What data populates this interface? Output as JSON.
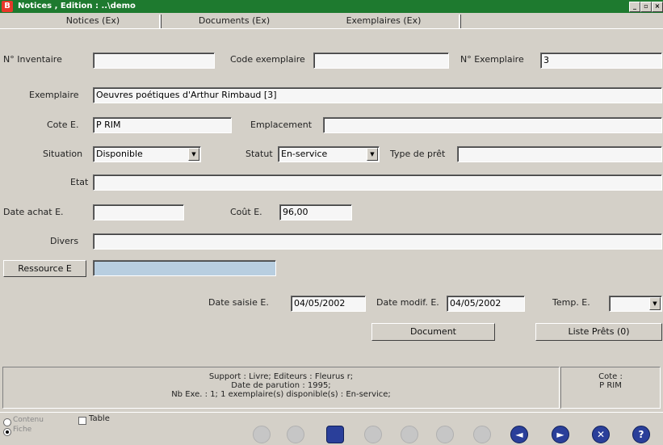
{
  "window": {
    "title": "Notices , Edition : ..\\demo",
    "app_badge": "B",
    "controls": {
      "minimize": "_",
      "restore": "▫",
      "close": "×"
    }
  },
  "tabs": [
    "Notices (Ex)",
    "Documents (Ex)",
    "Exemplaires (Ex)"
  ],
  "form": {
    "n_inventaire": {
      "label": "N° Inventaire",
      "value": ""
    },
    "code_exemplaire": {
      "label": "Code exemplaire",
      "value": ""
    },
    "n_exemplaire": {
      "label": "N° Exemplaire",
      "value": "3"
    },
    "exemplaire": {
      "label": "Exemplaire",
      "value": "Oeuvres poétiques d'Arthur Rimbaud [3]"
    },
    "cote": {
      "label": "Cote E.",
      "value": "P RIM"
    },
    "emplacement": {
      "label": "Emplacement",
      "value": ""
    },
    "situation": {
      "label": "Situation",
      "value": "Disponible"
    },
    "statut": {
      "label": "Statut",
      "value": "En-service"
    },
    "type_pret": {
      "label": "Type de prêt",
      "value": ""
    },
    "etat": {
      "label": "Etat",
      "value": ""
    },
    "date_achat": {
      "label": "Date achat E.",
      "value": ""
    },
    "cout": {
      "label": "Coût E.",
      "value": "96,00"
    },
    "divers": {
      "label": "Divers",
      "value": ""
    },
    "ressource": {
      "label": "Ressource E",
      "value": ""
    },
    "date_saisie": {
      "label": "Date saisie E.",
      "value": "04/05/2002"
    },
    "date_modif": {
      "label": "Date modif. E.",
      "value": "04/05/2002"
    },
    "temp": {
      "label": "Temp. E.",
      "value": ""
    }
  },
  "actions": {
    "document": "Document",
    "liste_prets": "Liste Prêts  (0)"
  },
  "info": {
    "line1": "Support : Livre;  Editeurs : Fleurus r;",
    "line2": "Date de parution : 1995;",
    "line3": "Nb Exe. : 1; 1 exemplaire(s) disponible(s) :  En-service;",
    "cote_label": "Cote :",
    "cote_value": "P RIM"
  },
  "bottom": {
    "radio_contenu": "Contenu",
    "radio_fiche": "Fiche",
    "check_table": "Table",
    "nav_first": "◄",
    "nav_last": "►",
    "close": "✕",
    "help": "?"
  },
  "colors": {
    "titlebar": "#1e7a2f",
    "field_blue": "#b8cee0",
    "nav_icon": "#2a3f9a"
  }
}
